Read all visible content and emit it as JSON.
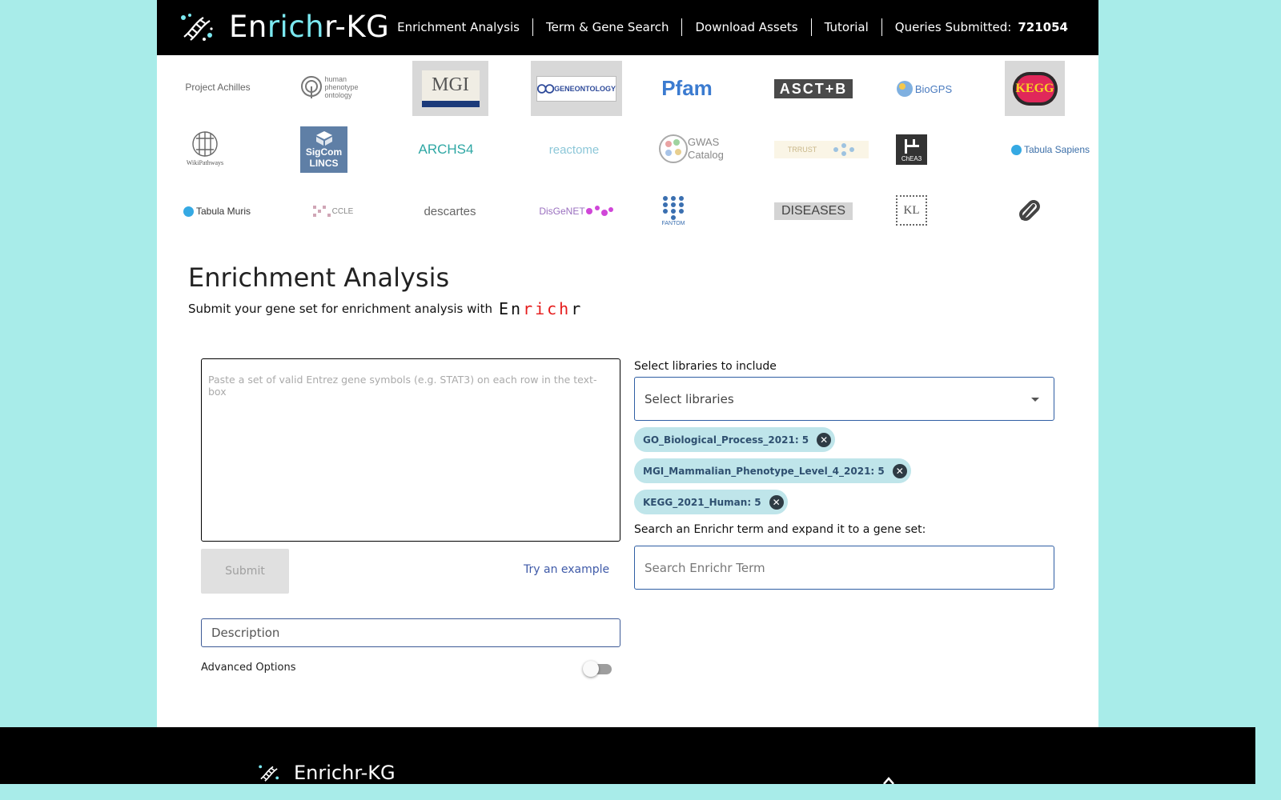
{
  "header": {
    "brand_prefix": "En",
    "brand_highlight": "rich",
    "brand_suffix": "r-KG",
    "nav": [
      {
        "label": "Enrichment Analysis"
      },
      {
        "label": "Term & Gene Search"
      },
      {
        "label": "Download Assets"
      },
      {
        "label": "Tutorial"
      }
    ],
    "queries_label": "Queries Submitted:",
    "queries_count": "721054"
  },
  "logos": [
    {
      "name": "project-achilles",
      "label": "Project Achilles"
    },
    {
      "name": "human-phenotype-ontology",
      "label": "human phenotype ontology"
    },
    {
      "name": "mgi",
      "label": "MGI"
    },
    {
      "name": "gene-ontology",
      "label": "GENEONTOLOGY"
    },
    {
      "name": "pfam",
      "label": "Pfam"
    },
    {
      "name": "asct-b",
      "label": "ASCT+B"
    },
    {
      "name": "biogps",
      "label": "BioGPS"
    },
    {
      "name": "kegg",
      "label": "KEGG"
    },
    {
      "name": "wikipathways",
      "label": "WikiPathways"
    },
    {
      "name": "sigcom-lincs",
      "label": "SigCom LINCS"
    },
    {
      "name": "archs4",
      "label": "ARCHS4"
    },
    {
      "name": "reactome",
      "label": "reactome"
    },
    {
      "name": "gwas-catalog",
      "label": "GWAS Catalog"
    },
    {
      "name": "trrust",
      "label": "TRRUST"
    },
    {
      "name": "chea3",
      "label": "ChEA3"
    },
    {
      "name": "tabula-sapiens",
      "label": "Tabula Sapiens"
    },
    {
      "name": "tabula-muris",
      "label": "Tabula Muris"
    },
    {
      "name": "ccle",
      "label": "CCLE"
    },
    {
      "name": "descartes",
      "label": "descartes"
    },
    {
      "name": "disgenet",
      "label": "DisGeNET"
    },
    {
      "name": "fantom",
      "label": "FANTOM"
    },
    {
      "name": "diseases",
      "label": "DISEASES"
    },
    {
      "name": "kl",
      "label": "KL"
    },
    {
      "name": "drug-pill",
      "label": ""
    }
  ],
  "main": {
    "title": "Enrichment Analysis",
    "subtitle": "Submit your gene set for enrichment analysis with",
    "wordmark_a": "En",
    "wordmark_b": "rich",
    "wordmark_c": "r",
    "gene_placeholder": "Paste a set of valid Entrez gene symbols (e.g. STAT3) on each row in the text-box",
    "submit_label": "Submit",
    "example_label": "Try an example",
    "description_placeholder": "Description",
    "advanced_label": "Advanced Options",
    "advanced_enabled": false,
    "libraries_label": "Select libraries to include",
    "libraries_placeholder": "Select libraries",
    "selected_libraries": [
      {
        "label": "GO_Biological_Process_2021: 5"
      },
      {
        "label": "MGI_Mammalian_Phenotype_Level_4_2021: 5"
      },
      {
        "label": "KEGG_2021_Human: 5"
      }
    ],
    "term_label": "Search an Enrichr term and expand it to a gene set:",
    "term_placeholder": "Search Enrichr Term"
  },
  "footer": {
    "brand": "Enrichr-KG"
  },
  "colors": {
    "background": "#a8ece9",
    "topbar": "#000000",
    "brand_highlight": "#7be8f0",
    "wordmark_red": "#e51b1b",
    "chip_bg": "#bfe5ea",
    "link": "#3f5aa8",
    "field_border": "#2f5ea3"
  }
}
